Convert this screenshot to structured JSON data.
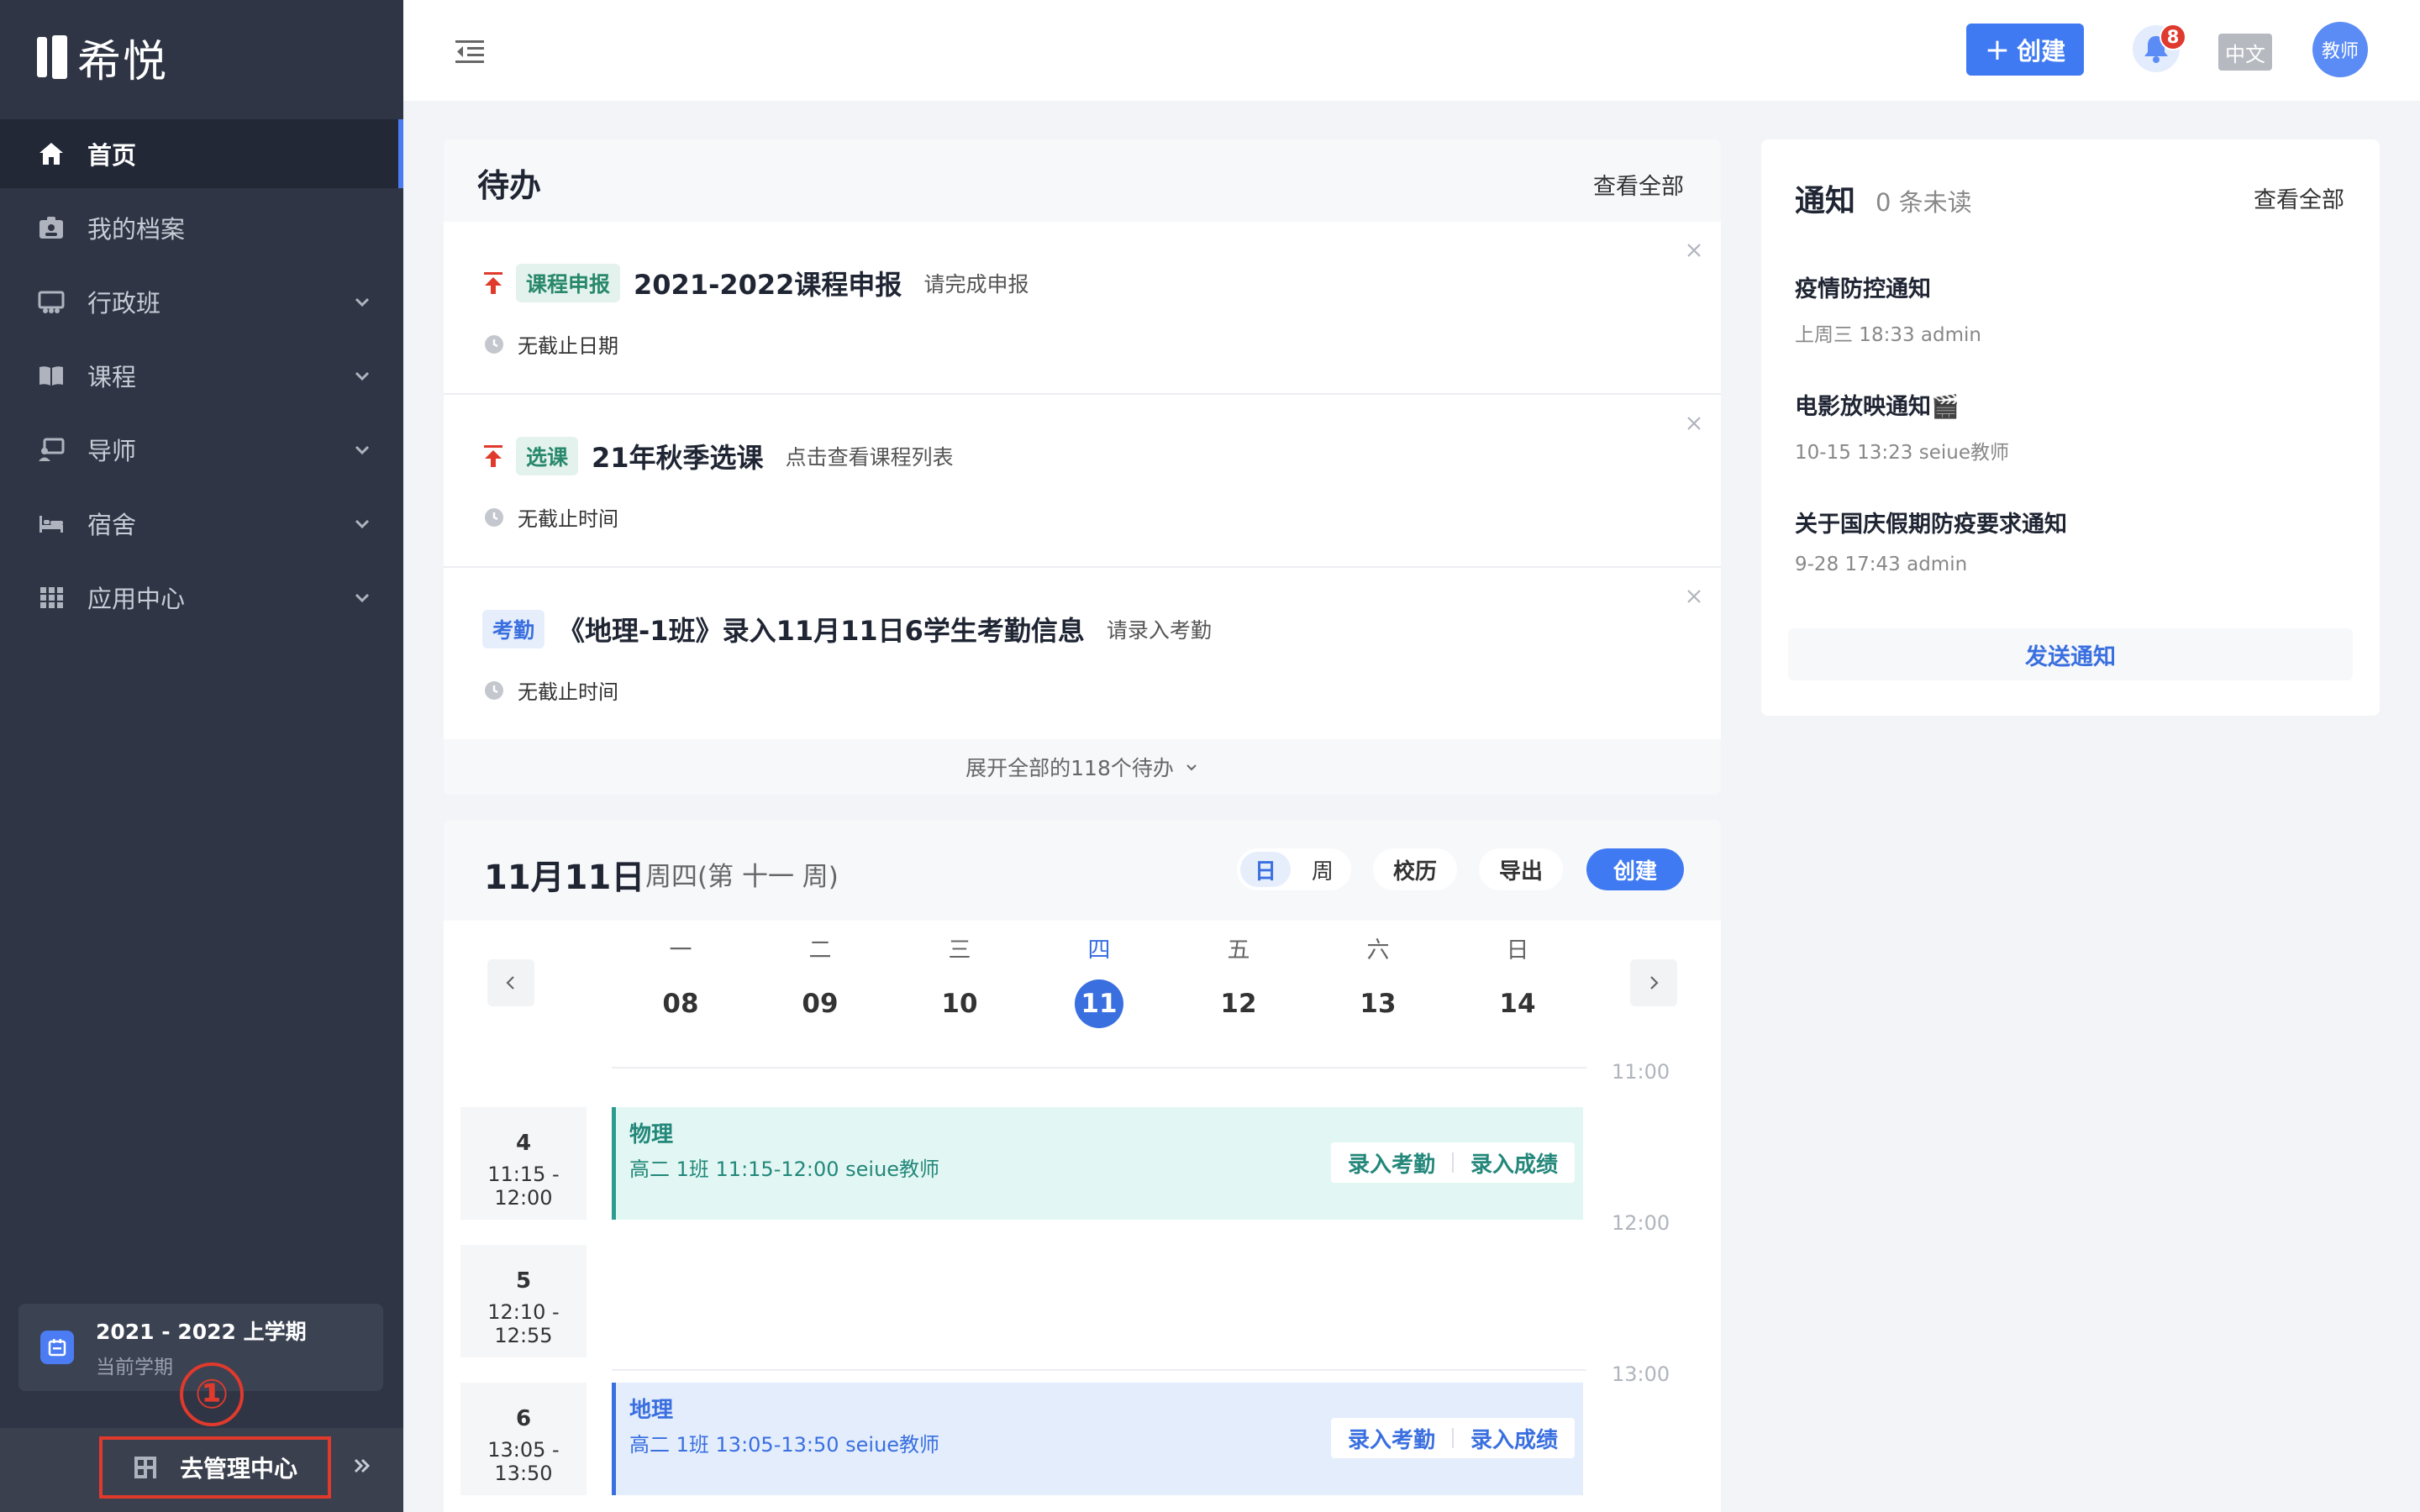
{
  "app": {
    "logo_text": "希悦"
  },
  "sidebar": {
    "items": [
      {
        "label": "首页",
        "icon": "home-icon",
        "active": true,
        "has_children": false
      },
      {
        "label": "我的档案",
        "icon": "profile-icon",
        "active": false,
        "has_children": false
      },
      {
        "label": "行政班",
        "icon": "class-icon",
        "active": false,
        "has_children": true
      },
      {
        "label": "课程",
        "icon": "book-icon",
        "active": false,
        "has_children": true
      },
      {
        "label": "导师",
        "icon": "mentor-icon",
        "active": false,
        "has_children": true
      },
      {
        "label": "宿舍",
        "icon": "bed-icon",
        "active": false,
        "has_children": true
      },
      {
        "label": "应用中心",
        "icon": "apps-icon",
        "active": false,
        "has_children": true
      }
    ],
    "semester": {
      "title": "2021 - 2022 上学期",
      "subtitle": "当前学期"
    },
    "annotation": "①",
    "admin_label": "去管理中心"
  },
  "topbar": {
    "create_label": "创建",
    "notification_count": "8",
    "language": "中文",
    "avatar_text": "教师"
  },
  "todo": {
    "title": "待办",
    "view_all": "查看全部",
    "items": [
      {
        "pinned": true,
        "tag": "课程申报",
        "tag_color": "green",
        "title": "2021-2022课程申报",
        "desc": "请完成申报",
        "deadline": "无截止日期"
      },
      {
        "pinned": true,
        "tag": "选课",
        "tag_color": "green",
        "title": "21年秋季选课",
        "desc": "点击查看课程列表",
        "deadline": "无截止时间"
      },
      {
        "pinned": false,
        "tag": "考勤",
        "tag_color": "blue",
        "title": "《地理-1班》录入11月11日6学生考勤信息",
        "desc": "请录入考勤",
        "deadline": "无截止时间"
      }
    ],
    "expand_label": "展开全部的118个待办"
  },
  "calendar": {
    "date": "11月11日",
    "week_info": "周四(第 十一 周)",
    "view_day": "日",
    "view_week": "周",
    "school_calendar": "校历",
    "export": "导出",
    "create": "创建",
    "days": [
      {
        "weekday": "一",
        "date": "08",
        "today": false
      },
      {
        "weekday": "二",
        "date": "09",
        "today": false
      },
      {
        "weekday": "三",
        "date": "10",
        "today": false
      },
      {
        "weekday": "四",
        "date": "11",
        "today": true
      },
      {
        "weekday": "五",
        "date": "12",
        "today": false
      },
      {
        "weekday": "六",
        "date": "13",
        "today": false
      },
      {
        "weekday": "日",
        "date": "14",
        "today": false
      }
    ],
    "time_labels": [
      "11:00",
      "12:00",
      "13:00"
    ],
    "periods": [
      {
        "number": "4",
        "time": "11:15 - 12:00"
      },
      {
        "number": "5",
        "time": "12:10 - 12:55"
      },
      {
        "number": "6",
        "time": "13:05 - 13:50"
      }
    ],
    "events": [
      {
        "title": "物理",
        "detail": "高二  1班  11:15-12:00  seiue教师",
        "color": "teal",
        "action_attendance": "录入考勤",
        "action_grades": "录入成绩"
      },
      {
        "title": "地理",
        "detail": "高二  1班  13:05-13:50  seiue教师",
        "color": "blue",
        "action_attendance": "录入考勤",
        "action_grades": "录入成绩"
      }
    ]
  },
  "notice": {
    "title": "通知",
    "unread": "0 条未读",
    "view_all": "查看全部",
    "items": [
      {
        "title": "疫情防控通知",
        "meta": "上周三 18:33   admin"
      },
      {
        "title": "电影放映通知🎬",
        "meta": "10-15 13:23   seiue教师"
      },
      {
        "title": "关于国庆假期防疫要求通知",
        "meta": "9-28 17:43   admin"
      }
    ],
    "send_label": "发送通知"
  },
  "colors": {
    "accent": "#3f7af2",
    "sidebar_bg": "#2f3544",
    "annotation": "#e03a2d"
  }
}
